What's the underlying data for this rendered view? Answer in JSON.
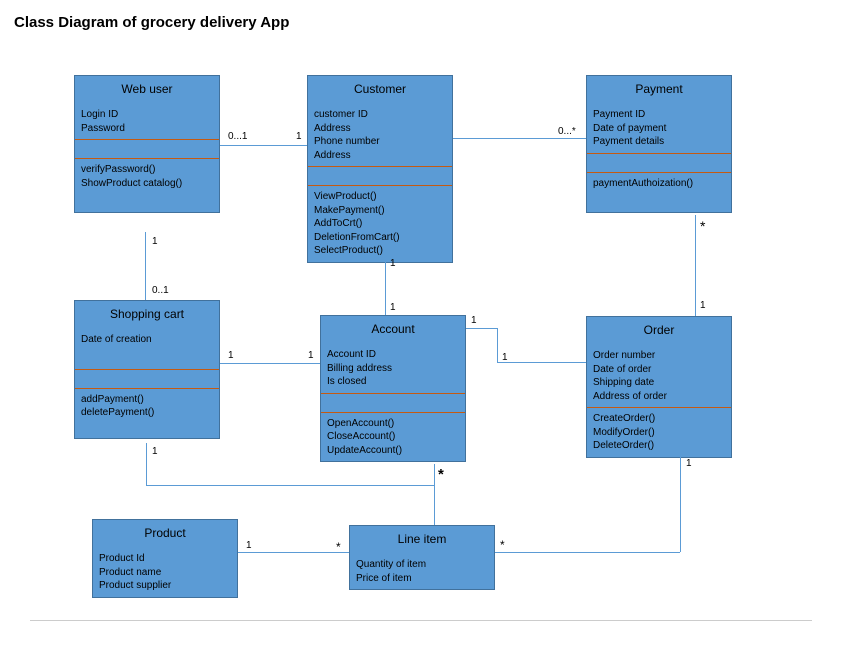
{
  "title": "Class Diagram of grocery delivery App",
  "classes": {
    "webuser": {
      "name": "Web user",
      "attrs": [
        "Login ID",
        "Password"
      ],
      "ops": [
        "verifyPassword()",
        "ShowProduct catalog()"
      ]
    },
    "customer": {
      "name": "Customer",
      "attrs": [
        "customer ID",
        "Address",
        "Phone number",
        "Address"
      ],
      "ops": [
        "ViewProduct()",
        "MakePayment()",
        "AddToCrt()",
        "DeletionFromCart()",
        "SelectProduct()"
      ]
    },
    "payment": {
      "name": "Payment",
      "attrs": [
        "Payment ID",
        "Date of payment",
        "Payment details"
      ],
      "ops": [
        "paymentAuthoization()"
      ]
    },
    "cart": {
      "name": "Shopping cart",
      "attrs": [
        "Date of creation"
      ],
      "ops": [
        "addPayment()",
        "deletePayment()"
      ]
    },
    "account": {
      "name": "Account",
      "attrs": [
        "Account ID",
        "Billing address",
        "Is closed"
      ],
      "ops": [
        "OpenAccount()",
        "CloseAccount()",
        "UpdateAccount()"
      ]
    },
    "order": {
      "name": "Order",
      "attrs": [
        "Order number",
        "Date of order",
        "Shipping date",
        "Address of order"
      ],
      "ops": [
        "CreateOrder()",
        "ModifyOrder()",
        "DeleteOrder()"
      ]
    },
    "product": {
      "name": "Product",
      "attrs": [
        "Product Id",
        "Product name",
        "Product supplier"
      ],
      "ops": []
    },
    "lineitem": {
      "name": "Line item",
      "attrs": [
        "Quantity of item",
        "Price of item"
      ],
      "ops": []
    }
  },
  "mult": {
    "webuser_customer_left": "0...1",
    "webuser_customer_right": "1",
    "webuser_cart_top": "1",
    "webuser_cart_bottom": "0..1",
    "cart_account_left": "1",
    "cart_account_right": "1",
    "customer_account_top": "1",
    "customer_account_bottom": "1",
    "customer_payment_right": "0...*",
    "account_order_left": "1",
    "account_order_right": "1",
    "payment_order_top": "*",
    "payment_order_bottom": "1",
    "cart_lineitem_top": "1",
    "account_lineitem_star": "*",
    "order_lineitem_top": "1",
    "order_lineitem_left": "*",
    "product_lineitem_left": "1",
    "product_lineitem_right": "*"
  }
}
